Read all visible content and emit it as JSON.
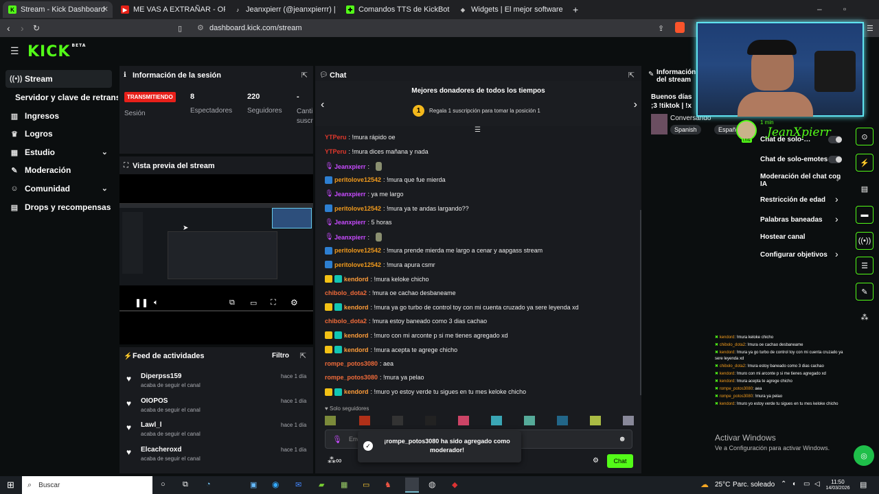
{
  "browser": {
    "tabs": [
      {
        "label": "Stream - Kick Dashboard"
      },
      {
        "label": "ME VAS A EXTRAÑAR - ORQUEST"
      },
      {
        "label": "Jeanxpierr (@jeanxpierrr) | TikTok"
      },
      {
        "label": "Comandos TTS de KickBot"
      },
      {
        "label": "Widgets | El mejor software para po"
      }
    ],
    "url": "dashboard.kick.com/stream"
  },
  "brand": {
    "logo": "KICK",
    "beta": "BETA",
    "accent": "#53fc18"
  },
  "sidebar": {
    "items": [
      {
        "label": "Stream",
        "icon": "stream-icon"
      },
      {
        "label": "Servidor y clave de retransmisión"
      },
      {
        "label": "Ingresos",
        "icon": "chart-icon"
      },
      {
        "label": "Logros",
        "icon": "trophy-icon"
      },
      {
        "label": "Estudio",
        "icon": "layout-icon"
      },
      {
        "label": "Moderación",
        "icon": "wrench-icon"
      },
      {
        "label": "Comunidad",
        "icon": "users-icon"
      },
      {
        "label": "Drops y recompensas",
        "icon": "drops-icon"
      }
    ]
  },
  "session": {
    "title": "Información de la sesión",
    "status": "TRANSMITIENDO",
    "status_sub": "Sesión",
    "stats": [
      {
        "value": "8",
        "label": "Espectadores"
      },
      {
        "value": "220",
        "label": "Seguidores"
      },
      {
        "value": "-",
        "label": "Canti suscr"
      }
    ]
  },
  "preview": {
    "title": "Vista previa del stream"
  },
  "feed": {
    "title": "Feed de actividades",
    "filter": "Filtro",
    "items": [
      {
        "user": "Diperpss159",
        "action": "acaba de seguir el canal",
        "time": "hace 1 día"
      },
      {
        "user": "OIOPOS",
        "action": "acaba de seguir el canal",
        "time": "hace 1 día"
      },
      {
        "user": "Lawl_l",
        "action": "acaba de seguir el canal",
        "time": "hace 1 día"
      },
      {
        "user": "Elcacheroxd",
        "action": "acaba de seguir el canal",
        "time": "hace 1 día"
      }
    ]
  },
  "chat": {
    "title": "Chat",
    "donors_title": "Mejores donadores de todos los tiempos",
    "donors_rank": "1",
    "donors_text": "Regala 1 suscripción para tomar la posición 1",
    "messages": [
      {
        "user": "YTPeru",
        "text": ": !mura rápido oe",
        "style": "red",
        "badges": []
      },
      {
        "user": "YTPeru",
        "text": ": !mura dices mañana y nada",
        "style": "red",
        "badges": []
      },
      {
        "user": "Jeanxpierr",
        "text": ":",
        "style": "purple",
        "badges": [
          "mic"
        ]
      },
      {
        "user": "peritolove12542",
        "text": ": !mura que fue mierda",
        "style": "orange",
        "badges": [
          "sub"
        ]
      },
      {
        "user": "Jeanxpierr",
        "text": ": ya me largo",
        "style": "purple",
        "badges": [
          "mic"
        ]
      },
      {
        "user": "peritolove12542",
        "text": ": !mura ya te andas largando??",
        "style": "orange",
        "badges": [
          "sub"
        ]
      },
      {
        "user": "Jeanxpierr",
        "text": ": 5 horas",
        "style": "purple",
        "badges": [
          "mic"
        ]
      },
      {
        "user": "Jeanxpierr",
        "text": ":",
        "style": "purple",
        "badges": [
          "mic"
        ]
      },
      {
        "user": "peritolove12542",
        "text": ": !mura prende mierda me largo a cenar y aapgass stream",
        "style": "orange",
        "badges": [
          "sub"
        ]
      },
      {
        "user": "peritolove12542",
        "text": ": !mura apura csmr",
        "style": "orange",
        "badges": [
          "sub"
        ]
      },
      {
        "user": "kendord",
        "text": ": !mura keloke chicho",
        "style": "gold",
        "badges": [
          "crown",
          "teal"
        ]
      },
      {
        "user": "chibolo_dota2",
        "text": ": !mura oe cachao desbaneame",
        "style": "chib",
        "badges": []
      },
      {
        "user": "kendord",
        "text": ": !mura ya go turbo de control toy con mi cuenta cruzado ya sere leyenda xd",
        "style": "gold",
        "badges": [
          "crown",
          "teal"
        ]
      },
      {
        "user": "chibolo_dota2",
        "text": ": !mura estoy baneado como 3 dias cachao",
        "style": "chib",
        "badges": []
      },
      {
        "user": "kendord",
        "text": ": !muro con mi arconte p si me tienes agregado xd",
        "style": "gold",
        "badges": [
          "crown",
          "teal"
        ]
      },
      {
        "user": "kendord",
        "text": ": !mura acepta te agrege chicho",
        "style": "gold",
        "badges": [
          "crown",
          "teal"
        ]
      },
      {
        "user": "rompe_potos3080",
        "text": ": aea",
        "style": "chib",
        "badges": []
      },
      {
        "user": "rompe_potos3080",
        "text": ": !mura ya pelao",
        "style": "chib",
        "badges": []
      },
      {
        "user": "kendord",
        "text": ": !muro yo estoy verde tu sigues en tu mes keloke chicho",
        "style": "gold",
        "badges": [
          "crown",
          "teal"
        ]
      }
    ],
    "followers_only": "Solo seguidores",
    "input_placeholder": "Env",
    "send": "Chat",
    "toast": "¡rompe_potos3080 ha sido agregado como moderador!"
  },
  "info": {
    "title": "Información del stream",
    "stream_title": "Buenos días ;3 !tiktok | !x",
    "category": "Conversando",
    "tags": [
      "Spanish",
      "Español"
    ]
  },
  "chat_settings": {
    "options": [
      {
        "label": "Chat de solo-…",
        "type": "toggle"
      },
      {
        "label": "Chat de solo-emotes",
        "type": "toggle"
      },
      {
        "label": "Moderación del chat con IA",
        "type": "external"
      },
      {
        "label": "Restricción de edad",
        "type": "chevron"
      },
      {
        "label": "Palabras baneadas",
        "type": "chevron"
      },
      {
        "label": "Hostear canal",
        "type": "none"
      },
      {
        "label": "Configurar objetivos",
        "type": "chevron"
      }
    ]
  },
  "webcam": {
    "name": "JeanXpierr",
    "time": "1 min",
    "live": "LIVE"
  },
  "overlay_chat": [
    {
      "user": "kendord",
      "text": ": !mura keloke chicho"
    },
    {
      "user": "chibolo_dota2",
      "text": ": !mura oe cachao desbaneame"
    },
    {
      "user": "kendord",
      "text": ": !mura ya go turbo de control toy con mi cuenta cruzado ya sere leyenda xd"
    },
    {
      "user": "chibolo_dota2",
      "text": ": !mura estoy baneado como 3 dias cachao"
    },
    {
      "user": "kendord",
      "text": ": !muro con mi arconte p si me tienes agregado xd"
    },
    {
      "user": "kendord",
      "text": ": !mura acepta te agrege chicho"
    },
    {
      "user": "rompe_potos3080",
      "text": ": aea"
    },
    {
      "user": "rompe_potos3080",
      "text": ": !mura ya pelao"
    },
    {
      "user": "kendord",
      "text": ": !muro yo estoy verde tu sigues en tu mes keloke chicho"
    }
  ],
  "windows_watermark": {
    "title": "Activar Windows",
    "sub": "Ve a Configuración para activar Windows."
  },
  "taskbar": {
    "search": "Buscar",
    "weather": "25°C",
    "weather_desc": "Parc. soleado",
    "time": "11:50",
    "date": "14/03/2026"
  }
}
